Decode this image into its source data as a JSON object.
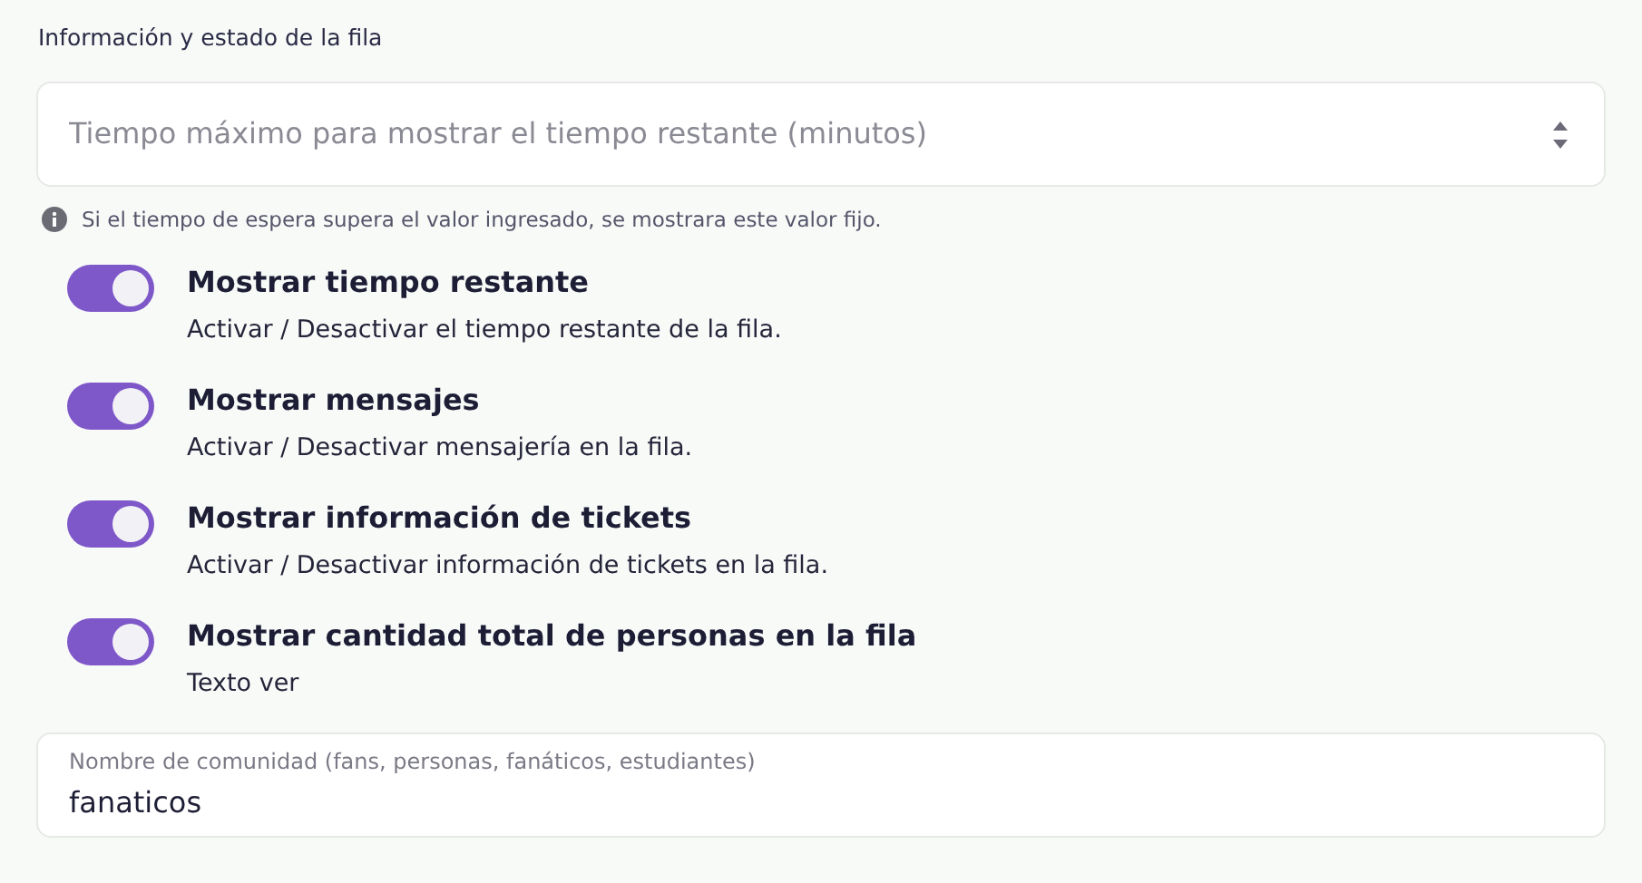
{
  "section_title": "Información y estado de la fila",
  "max_time_field": {
    "placeholder": "Tiempo máximo para mostrar el tiempo restante (minutos)"
  },
  "hint": "Si el tiempo de espera supera el valor ingresado, se mostrara este valor fijo.",
  "toggles": [
    {
      "label": "Mostrar tiempo restante",
      "description": "Activar / Desactivar el tiempo restante de la fila.",
      "on": true
    },
    {
      "label": "Mostrar mensajes",
      "description": "Activar / Desactivar mensajería en la fila.",
      "on": true
    },
    {
      "label": "Mostrar información de tickets",
      "description": "Activar / Desactivar información de tickets en la fila.",
      "on": true
    },
    {
      "label": "Mostrar cantidad total de personas en la fila",
      "description": "Texto ver",
      "on": true
    }
  ],
  "community_field": {
    "label": "Nombre de comunidad (fans, personas, fanáticos, estudiantes)",
    "value": "fanaticos"
  }
}
